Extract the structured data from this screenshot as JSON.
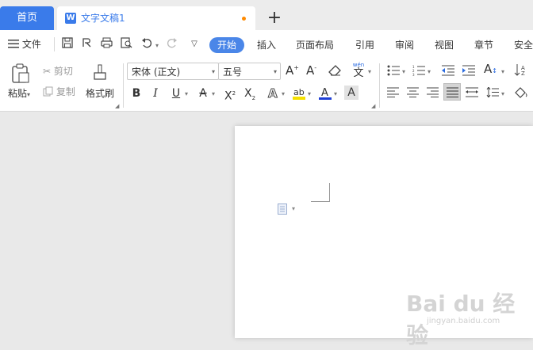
{
  "tabs": {
    "home": "首页",
    "document": "文字文稿1",
    "new_tab": "+"
  },
  "menu": {
    "file": "文件",
    "tabs": [
      "开始",
      "插入",
      "页面布局",
      "引用",
      "审阅",
      "视图",
      "章节",
      "安全"
    ]
  },
  "ribbon": {
    "paste": "粘贴",
    "cut": "剪切",
    "copy": "复制",
    "format_painter": "格式刷",
    "font_name": "宋体 (正文)",
    "font_size": "五号",
    "phonetic": "wén"
  },
  "watermark": {
    "text": "Bai du 经验",
    "sub": "jingyan.baidu.com"
  },
  "colors": {
    "accent": "#3a7bea",
    "font_color_bar": "#1f3fd6",
    "highlight_bar": "#f5e000"
  }
}
